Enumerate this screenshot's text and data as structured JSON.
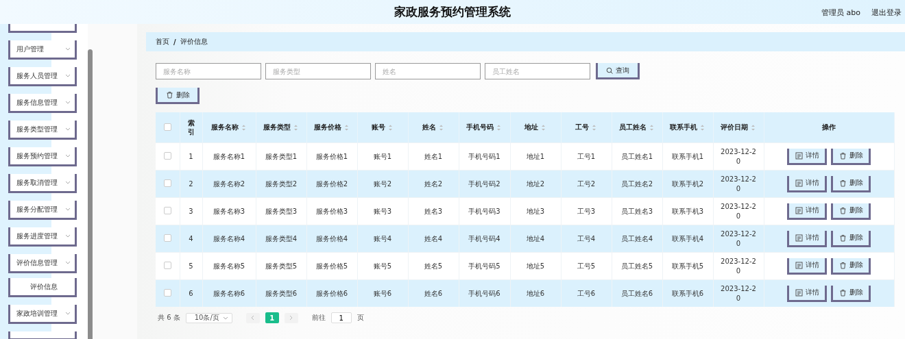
{
  "header": {
    "title": "家政服务预约管理系统",
    "user": "管理员 abo",
    "logout": "退出登录"
  },
  "sidebar": {
    "items": [
      {
        "kind": "cut"
      },
      {
        "kind": "menu",
        "label": "用户管理"
      },
      {
        "kind": "menu",
        "label": "服务人员管理"
      },
      {
        "kind": "menu",
        "label": "服务信息管理"
      },
      {
        "kind": "menu",
        "label": "服务类型管理"
      },
      {
        "kind": "menu",
        "label": "服务预约管理"
      },
      {
        "kind": "menu",
        "label": "服务取消管理"
      },
      {
        "kind": "menu",
        "label": "服务分配管理"
      },
      {
        "kind": "menu",
        "label": "服务进度管理"
      },
      {
        "kind": "menu",
        "label": "评价信息管理",
        "children": [
          {
            "label": "评价信息"
          }
        ]
      },
      {
        "kind": "menu",
        "label": "家政培训管理"
      },
      {
        "kind": "cut"
      }
    ]
  },
  "breadcrumb": {
    "items": [
      "首页",
      "评价信息"
    ],
    "separator": "/"
  },
  "search": {
    "fields": [
      {
        "placeholder": "服务名称"
      },
      {
        "placeholder": "服务类型"
      },
      {
        "placeholder": "姓名"
      },
      {
        "placeholder": "员工姓名"
      }
    ],
    "button": "查询"
  },
  "toolbar": {
    "delete": "删除"
  },
  "table": {
    "select_all": {
      "checked": false
    },
    "columns": [
      {
        "label": "索引",
        "sortable": false
      },
      {
        "label": "服务名称",
        "sortable": true
      },
      {
        "label": "服务类型",
        "sortable": true
      },
      {
        "label": "服务价格",
        "sortable": true
      },
      {
        "label": "账号",
        "sortable": true
      },
      {
        "label": "姓名",
        "sortable": true
      },
      {
        "label": "手机号码",
        "sortable": true
      },
      {
        "label": "地址",
        "sortable": true
      },
      {
        "label": "工号",
        "sortable": true
      },
      {
        "label": "员工姓名",
        "sortable": true
      },
      {
        "label": "联系手机",
        "sortable": true
      },
      {
        "label": "评价日期",
        "sortable": true
      },
      {
        "label": "操作",
        "sortable": false
      }
    ],
    "rows": [
      {
        "checked": false,
        "cells": [
          "1",
          "服务名称1",
          "服务类型1",
          "服务价格1",
          "账号1",
          "姓名1",
          "手机号码1",
          "地址1",
          "工号1",
          "员工姓名1",
          "联系手机1",
          "2023-12-20"
        ],
        "actions": [
          "详情",
          "删除"
        ]
      },
      {
        "checked": false,
        "cells": [
          "2",
          "服务名称2",
          "服务类型2",
          "服务价格2",
          "账号2",
          "姓名2",
          "手机号码2",
          "地址2",
          "工号2",
          "员工姓名2",
          "联系手机2",
          "2023-12-20"
        ],
        "actions": [
          "详情",
          "删除"
        ]
      },
      {
        "checked": false,
        "cells": [
          "3",
          "服务名称3",
          "服务类型3",
          "服务价格3",
          "账号3",
          "姓名3",
          "手机号码3",
          "地址3",
          "工号3",
          "员工姓名3",
          "联系手机3",
          "2023-12-20"
        ],
        "actions": [
          "详情",
          "删除"
        ]
      },
      {
        "checked": false,
        "cells": [
          "4",
          "服务名称4",
          "服务类型4",
          "服务价格4",
          "账号4",
          "姓名4",
          "手机号码4",
          "地址4",
          "工号4",
          "员工姓名4",
          "联系手机4",
          "2023-12-20"
        ],
        "actions": [
          "详情",
          "删除"
        ]
      },
      {
        "checked": false,
        "cells": [
          "5",
          "服务名称5",
          "服务类型5",
          "服务价格5",
          "账号5",
          "姓名5",
          "手机号码5",
          "地址5",
          "工号5",
          "员工姓名5",
          "联系手机5",
          "2023-12-20"
        ],
        "actions": [
          "详情",
          "删除"
        ]
      },
      {
        "checked": false,
        "cells": [
          "6",
          "服务名称6",
          "服务类型6",
          "服务价格6",
          "账号6",
          "姓名6",
          "手机号码6",
          "地址6",
          "工号6",
          "员工姓名6",
          "联系手机6",
          "2023-12-20"
        ],
        "actions": [
          "详情",
          "删除"
        ]
      }
    ]
  },
  "pagination": {
    "total": "共 6 条",
    "page_size": "10条/页",
    "prev_disabled": true,
    "next_disabled": true,
    "pages": [
      {
        "label": "1",
        "selected": true
      }
    ],
    "goto": "前往",
    "goto_value": "1",
    "page_unit": "页"
  }
}
